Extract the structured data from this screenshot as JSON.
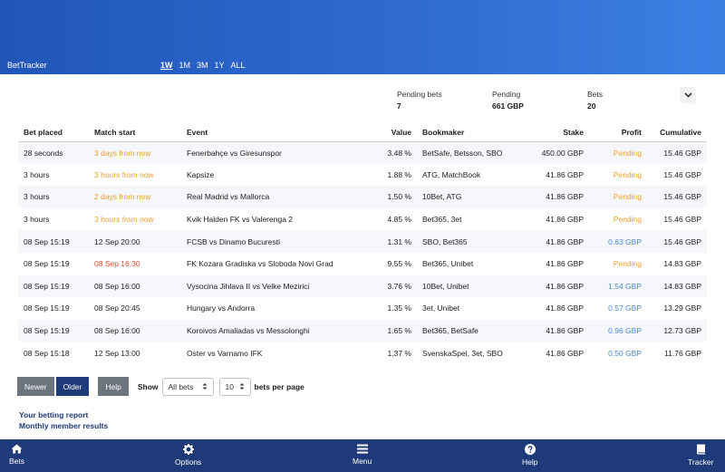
{
  "header": {
    "app_title": "BetTracker",
    "ranges": [
      "1W",
      "1M",
      "3M",
      "1Y",
      "ALL"
    ],
    "active_range": "1W"
  },
  "summary": [
    {
      "label": "Pending bets",
      "value": "7"
    },
    {
      "label": "Pending",
      "value": "661 GBP"
    },
    {
      "label": "Bets",
      "value": "20"
    }
  ],
  "table": {
    "columns": [
      "Bet placed",
      "Match start",
      "Event",
      "Value",
      "Bookmaker",
      "Stake",
      "Profit",
      "Cumulative"
    ],
    "rows": [
      {
        "placed": "28 seconds",
        "start": "3 days from now",
        "event": "Fenerbahçe vs Giresunspor",
        "value": "3.48 %",
        "bookmaker": "BetSafe, Betsson, SBO",
        "stake": "450.00 GBP",
        "profit": "Pending",
        "cumulative": "15.46 GBP"
      },
      {
        "placed": "3 hours",
        "start": "3 hours from now",
        "event": "Kapsize",
        "value": "1.88 %",
        "bookmaker": "ATG, MatchBook",
        "stake": "41.86 GBP",
        "profit": "Pending",
        "cumulative": "15.46 GBP"
      },
      {
        "placed": "3 hours",
        "start": "2 days from now",
        "event": "Real Madrid vs Mallorca",
        "value": "1.50 %",
        "bookmaker": "10Bet, ATG",
        "stake": "41.86 GBP",
        "profit": "Pending",
        "cumulative": "15.46 GBP"
      },
      {
        "placed": "3 hours",
        "start": "3 hours from now",
        "event": "Kvik Halden FK vs Valerenga 2",
        "value": "4.85 %",
        "bookmaker": "Bet365, 3et",
        "stake": "41.86 GBP",
        "profit": "Pending",
        "cumulative": "15.46 GBP"
      },
      {
        "placed": "08 Sep 15:19",
        "start": "12 Sep 20:00",
        "event": "FCSB vs Dinamo Bucuresti",
        "value": "1.31 %",
        "bookmaker": "SBO, Bet365",
        "stake": "41.86 GBP",
        "profit": "0.63 GBP",
        "cumulative": "15.46 GBP"
      },
      {
        "placed": "08 Sep 15:19",
        "start": "08 Sep 16:30",
        "event": "FK Kozara Gradiska vs Sloboda Novi Grad",
        "value": "9.55 %",
        "bookmaker": "Bet365, Unibet",
        "stake": "41.86 GBP",
        "profit": "Pending",
        "cumulative": "14.83 GBP"
      },
      {
        "placed": "08 Sep 15:19",
        "start": "08 Sep 16:00",
        "event": "Vysocina Jihlava II vs Velke Mezirici",
        "value": "3.76 %",
        "bookmaker": "10Bet, Unibet",
        "stake": "41.86 GBP",
        "profit": "1.54 GBP",
        "cumulative": "14.83 GBP"
      },
      {
        "placed": "08 Sep 15:19",
        "start": "08 Sep 20:45",
        "event": "Hungary vs Andorra",
        "value": "1.35 %",
        "bookmaker": "3et, Unibet",
        "stake": "41.86 GBP",
        "profit": "0.57 GBP",
        "cumulative": "13.29 GBP"
      },
      {
        "placed": "08 Sep 15:19",
        "start": "08 Sep 16:00",
        "event": "Koroivos Amaliadas vs Messolonghi",
        "value": "1.65 %",
        "bookmaker": "Bet365, BetSafe",
        "stake": "41.86 GBP",
        "profit": "0.96 GBP",
        "cumulative": "12.73 GBP"
      },
      {
        "placed": "08 Sep 15:18",
        "start": "12 Sep 13:00",
        "event": "Oster vs Varnamo IFK",
        "value": "1.37 %",
        "bookmaker": "SvenskaSpel, 3et, SBO",
        "stake": "41.86 GBP",
        "profit": "0.50 GBP",
        "cumulative": "11.76 GBP"
      }
    ]
  },
  "pager": {
    "newer": "Newer",
    "older": "Older",
    "help": "Help",
    "show_label": "Show",
    "filter_value": "All bets",
    "per_page_value": "10",
    "per_page_label": "bets per page"
  },
  "links": [
    "Your betting report",
    "Monthly member results"
  ],
  "bottom_nav": [
    {
      "label": "Bets",
      "icon": "home-icon"
    },
    {
      "label": "Options",
      "icon": "gear-icon"
    },
    {
      "label": "Menu",
      "icon": "hamburger-icon"
    },
    {
      "label": "Help",
      "icon": "question-circle-icon"
    },
    {
      "label": "Tracker",
      "icon": "book-icon"
    }
  ],
  "colors": {
    "pending": "#f0a030",
    "past_start": "#e34a34",
    "profit": "#4a8ad4",
    "nav_bg": "#1f3a78"
  }
}
